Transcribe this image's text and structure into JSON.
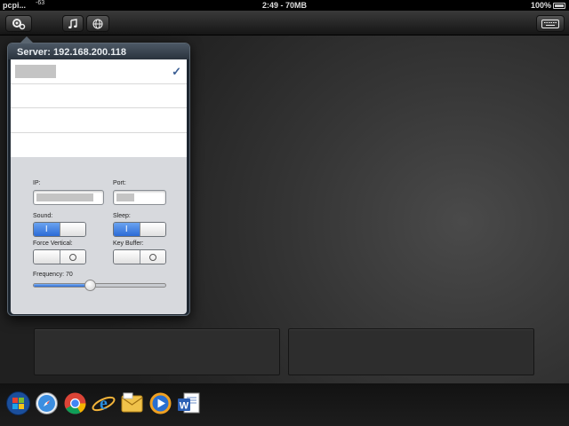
{
  "status_bar": {
    "carrier": "pcpi...",
    "signal": "-63",
    "time_memory": "2:49 - 70MB",
    "battery": "100%"
  },
  "toolbar": {
    "settings_icon": "gear-cluster-icon",
    "music_icon": "music-note-icon",
    "web_icon": "globe-icon",
    "keyboard_icon": "keyboard-icon"
  },
  "popover": {
    "title": "Server: 192.168.200.118",
    "servers": [
      {
        "selected": true
      },
      {
        "selected": false
      },
      {
        "selected": false
      },
      {
        "selected": false
      }
    ],
    "check_mark": "✓",
    "settings": {
      "ip_label": "IP:",
      "port_label": "Port:",
      "sound_label": "Sound:",
      "sleep_label": "Sleep:",
      "force_vertical_label": "Force Vertical:",
      "key_buffer_label": "Key Buffer:",
      "frequency_label": "Frequency: 70",
      "toggle_on_glyph": "I",
      "sound": true,
      "sleep": true,
      "force_vertical": false,
      "key_buffer": false,
      "frequency_fraction": 0.43
    }
  },
  "dock_apps": [
    "windows-start-icon",
    "safari-icon",
    "chrome-icon",
    "internet-explorer-icon",
    "outlook-icon",
    "windows-media-player-icon",
    "word-icon"
  ],
  "colors": {
    "accent_blue": "#2c6bd6",
    "popover_header": "#4c5865",
    "check_blue": "#3c5f94"
  }
}
